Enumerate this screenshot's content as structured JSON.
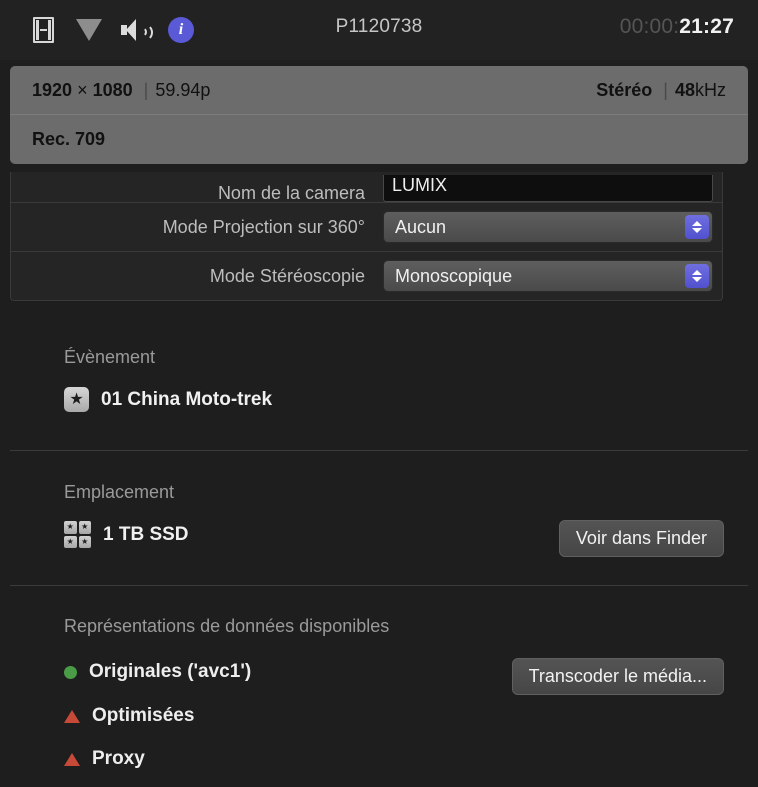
{
  "toolbar": {
    "icons": [
      {
        "name": "film-strip-icon",
        "label": "Film strip"
      },
      {
        "name": "filter-triangle-icon",
        "label": "Filter"
      },
      {
        "name": "speaker-icon",
        "label": "Audio"
      },
      {
        "name": "info-icon",
        "label": "i"
      }
    ],
    "title": "P1120738",
    "timecode_dim": "00:00:",
    "timecode_lit": "21:27"
  },
  "summary": {
    "width": "1920",
    "times": "×",
    "height": "1080",
    "divider": "|",
    "framerate": "59.94p",
    "audio_channels": "Stéréo",
    "audio_divider": "|",
    "audio_rate_value": "48",
    "audio_rate_unit": "kHz",
    "colorspace": "Rec. 709"
  },
  "properties": [
    {
      "label": "Nom de la camera",
      "type": "text",
      "value": "LUMIX",
      "clipped": true
    },
    {
      "label": "Mode Projection sur 360°",
      "type": "popup",
      "value": "Aucun",
      "clipped": false
    },
    {
      "label": "Mode Stéréoscopie",
      "type": "popup",
      "value": "Monoscopique",
      "clipped": false
    }
  ],
  "event": {
    "section_title": "Évènement",
    "icon": "star-icon",
    "star_glyph": "★",
    "name": "01 China Moto-trek"
  },
  "location": {
    "section_title": "Emplacement",
    "icon": "drive-icon",
    "star_glyph": "★",
    "volume": "1 TB SSD",
    "button_label": "Voir dans Finder"
  },
  "representations": {
    "section_title": "Représentations de données disponibles",
    "button_label": "Transcoder le média...",
    "items": [
      {
        "status": "available",
        "icon": "green-dot-icon",
        "label": "Originales ('avc1')"
      },
      {
        "status": "missing",
        "icon": "red-triangle-icon",
        "label": "Optimisées"
      },
      {
        "status": "missing",
        "icon": "red-triangle-icon",
        "label": "Proxy"
      }
    ]
  },
  "colors": {
    "background": "#1e1e1e",
    "toolbar": "#222222",
    "summary_panel": "#6c6c6c",
    "accent_blue": "#5a5ad6",
    "status_green": "#4a9c46",
    "status_red": "#c74a39",
    "divider": "#3b3b3b"
  }
}
